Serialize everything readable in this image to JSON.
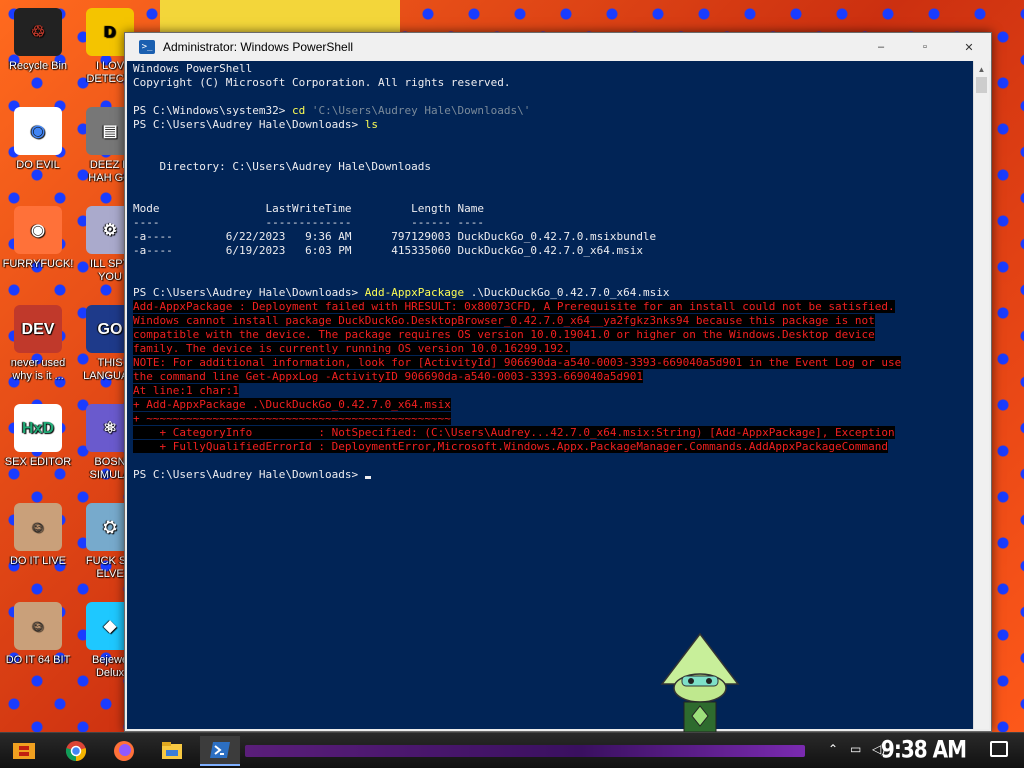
{
  "desktop": {
    "icons": [
      {
        "label": "Recycle Bin"
      },
      {
        "label": "I LOV\nDETECTI"
      },
      {
        "label": "DO EVIL"
      },
      {
        "label": "DEEZ N\nHAH GO"
      },
      {
        "label": "FURRYFUCK!"
      },
      {
        "label": "ILL SPY\nYOU"
      },
      {
        "label": "never used\nwhy is it ..."
      },
      {
        "label": "THIS\nLANGUAG"
      },
      {
        "label": "SEX EDITOR"
      },
      {
        "label": "BOSN\nSIMULA"
      },
      {
        "label": "DO IT LIVE"
      },
      {
        "label": "FUCK SC\nELVE"
      },
      {
        "label": "DO IT 64 BIT"
      },
      {
        "label": "Bejewe\nDelux"
      }
    ]
  },
  "window": {
    "title": "Administrator: Windows PowerShell",
    "logo_glyph": ">_",
    "minimize_glyph": "–",
    "maximize_glyph": "▫",
    "close_glyph": "✕"
  },
  "console": {
    "lines": [
      {
        "text": "Windows PowerShell",
        "style": "white"
      },
      {
        "text": "Copyright (C) Microsoft Corporation. All rights reserved.",
        "style": "white"
      },
      {
        "text": "",
        "style": "white"
      },
      {
        "prompt": "PS C:\\Windows\\system32> ",
        "cmd": "cd",
        "arg": " 'C:\\Users\\Audrey Hale\\Downloads\\'"
      },
      {
        "prompt": "PS C:\\Users\\Audrey Hale\\Downloads> ",
        "cmd": "ls",
        "arg": ""
      },
      {
        "text": "",
        "style": "white"
      },
      {
        "text": "",
        "style": "white"
      },
      {
        "text": "    Directory: C:\\Users\\Audrey Hale\\Downloads",
        "style": "white"
      },
      {
        "text": "",
        "style": "white"
      },
      {
        "text": "",
        "style": "white"
      },
      {
        "text": "Mode                LastWriteTime         Length Name",
        "style": "white"
      },
      {
        "text": "----                -------------         ------ ----",
        "style": "white"
      },
      {
        "text": "-a----        6/22/2023   9:36 AM      797129003 DuckDuckGo_0.42.7.0.msixbundle",
        "style": "white"
      },
      {
        "text": "-a----        6/19/2023   6:03 PM      415335060 DuckDuckGo_0.42.7.0_x64.msix",
        "style": "white"
      },
      {
        "text": "",
        "style": "white"
      },
      {
        "text": "",
        "style": "white"
      },
      {
        "prompt": "PS C:\\Users\\Audrey Hale\\Downloads> ",
        "cmd": "Add-AppxPackage",
        "arg": " .\\DuckDuckGo_0.42.7.0_x64.msix"
      },
      {
        "text": "Add-AppxPackage : Deployment failed with HRESULT: 0x80073CFD, A Prerequisite for an install could not be satisfied.",
        "style": "error"
      },
      {
        "text": "Windows cannot install package DuckDuckGo.DesktopBrowser_0.42.7.0_x64__ya2fgkz3nks94 because this package is not",
        "style": "error"
      },
      {
        "text": "compatible with the device. The package requires OS version 10.0.19041.0 or higher on the Windows.Desktop device",
        "style": "error"
      },
      {
        "text": "family. The device is currently running OS version 10.0.16299.192.",
        "style": "error"
      },
      {
        "text": "NOTE: For additional information, look for [ActivityId] 906690da-a540-0003-3393-669040a5d901 in the Event Log or use",
        "style": "error"
      },
      {
        "text": "the command line Get-AppxLog -ActivityID 906690da-a540-0003-3393-669040a5d901",
        "style": "error"
      },
      {
        "text": "At line:1 char:1",
        "style": "error"
      },
      {
        "text": "+ Add-AppxPackage .\\DuckDuckGo_0.42.7.0_x64.msix",
        "style": "error"
      },
      {
        "text": "+ ~~~~~~~~~~~~~~~~~~~~~~~~~~~~~~~~~~~~~~~~~~~~~~",
        "style": "error"
      },
      {
        "text": "    + CategoryInfo          : NotSpecified: (C:\\Users\\Audrey...42.7.0_x64.msix:String) [Add-AppxPackage], Exception",
        "style": "error"
      },
      {
        "text": "    + FullyQualifiedErrorId : DeploymentError,Microsoft.Windows.Appx.PackageManager.Commands.AddAppxPackageCommand",
        "style": "error"
      },
      {
        "text": "",
        "style": "white"
      },
      {
        "prompt": "PS C:\\Users\\Audrey Hale\\Downloads> ",
        "cmd": "",
        "arg": "",
        "cursor": true
      }
    ]
  },
  "taskbar": {
    "clock": "9:38 AM",
    "apps": [
      "start",
      "chrome",
      "firefox",
      "file-explorer",
      "powershell"
    ]
  },
  "colors": {
    "console_bg": "#012456",
    "console_text": "#eeedf0",
    "command_yellow": "#fdfd54",
    "error_red": "#f02020"
  }
}
